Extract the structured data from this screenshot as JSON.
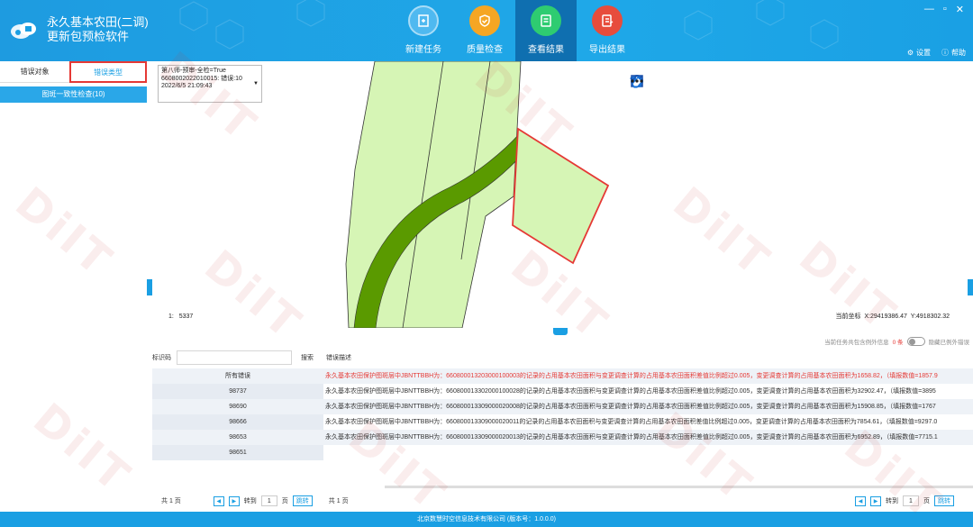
{
  "app": {
    "title_line1": "永久基本农田(二调)",
    "title_line2": "更新包预检软件"
  },
  "nav": [
    {
      "label": "新建任务",
      "icon": "new-task-icon",
      "color": "#4fb9f0"
    },
    {
      "label": "质量检查",
      "icon": "shield-check-icon",
      "color": "#f5a623"
    },
    {
      "label": "查看结果",
      "icon": "view-result-icon",
      "color": "#2ecc71",
      "active": true
    },
    {
      "label": "导出结果",
      "icon": "export-icon",
      "color": "#e74c3c"
    }
  ],
  "header": {
    "settings": "设置",
    "help": "帮助"
  },
  "left": {
    "tab_object": "错误对象",
    "tab_type": "错误类型",
    "category": "图斑一致性检查(10)"
  },
  "map": {
    "info_lines": [
      "第八师-预审-全检=True",
      "6608002022010015: 错误:10",
      "2022/6/5 21:09:43"
    ],
    "scale_label": "1:",
    "scale_value": "5337",
    "coord_label": "当前坐标",
    "coord_x": "X:29419386.47",
    "coord_y": "Y:4918302.32"
  },
  "options": {
    "info_text": "当前任务共包含例外信息",
    "count": "0 条",
    "hide_label": "隐藏已例外错误"
  },
  "table": {
    "search_label": "标识码",
    "search_button": "搜索",
    "desc_header": "错误描述",
    "rows": [
      {
        "id": "所有错误",
        "desc": "永久基本农田保护图斑层中JBNTTBBH为：660800013203000100003的记录的占用基本农田面积与变更调查计算的占用基本农田面积差值比例超过0.005，变更调查计算的占用基本农田面积为1658.82，（填报数值=1857.9"
      },
      {
        "id": "98737",
        "desc": "永久基本农田保护图斑层中JBNTTBBH为：660800013302000100028的记录的占用基本农田面积与变更调查计算的占用基本农田面积差值比例超过0.005，变更调查计算的占用基本农田面积为32902.47，（填报数值=3895"
      },
      {
        "id": "98690",
        "desc": "永久基本农田保护图斑层中JBNTTBBH为：660800013309000020008的记录的占用基本农田面积与变更调查计算的占用基本农田面积差值比例超过0.005，变更调查计算的占用基本农田面积为15908.85，（填报数值=1767"
      },
      {
        "id": "98666",
        "desc": "永久基本农田保护图斑层中JBNTTBBH为：660800013309000020011的记录的占用基本农田面积与变更调查计算的占用基本农田面积差值比例超过0.005，变更调查计算的占用基本农田面积为7854.61，（填报数值=9297.0"
      },
      {
        "id": "98653",
        "desc": "永久基本农田保护图斑层中JBNTTBBH为：660800013309000020013的记录的占用基本农田面积与变更调查计算的占用基本农田面积差值比例超过0.005，变更调查计算的占用基本农田面积为6952.89，（填报数值=7715.1"
      },
      {
        "id": "98651",
        "desc": ""
      }
    ]
  },
  "pager_left": {
    "total": "共 1 页",
    "goto": "转到",
    "page": "1",
    "unit": "页",
    "go": "跳转",
    "total2": "共 1 页"
  },
  "pager_right": {
    "goto": "转到",
    "page": "1",
    "unit": "页",
    "go": "跳转"
  },
  "footer": {
    "text": "北京数慧时空信息技术有限公司 (版本号：1.0.0.0)"
  },
  "watermark": "DiIT"
}
